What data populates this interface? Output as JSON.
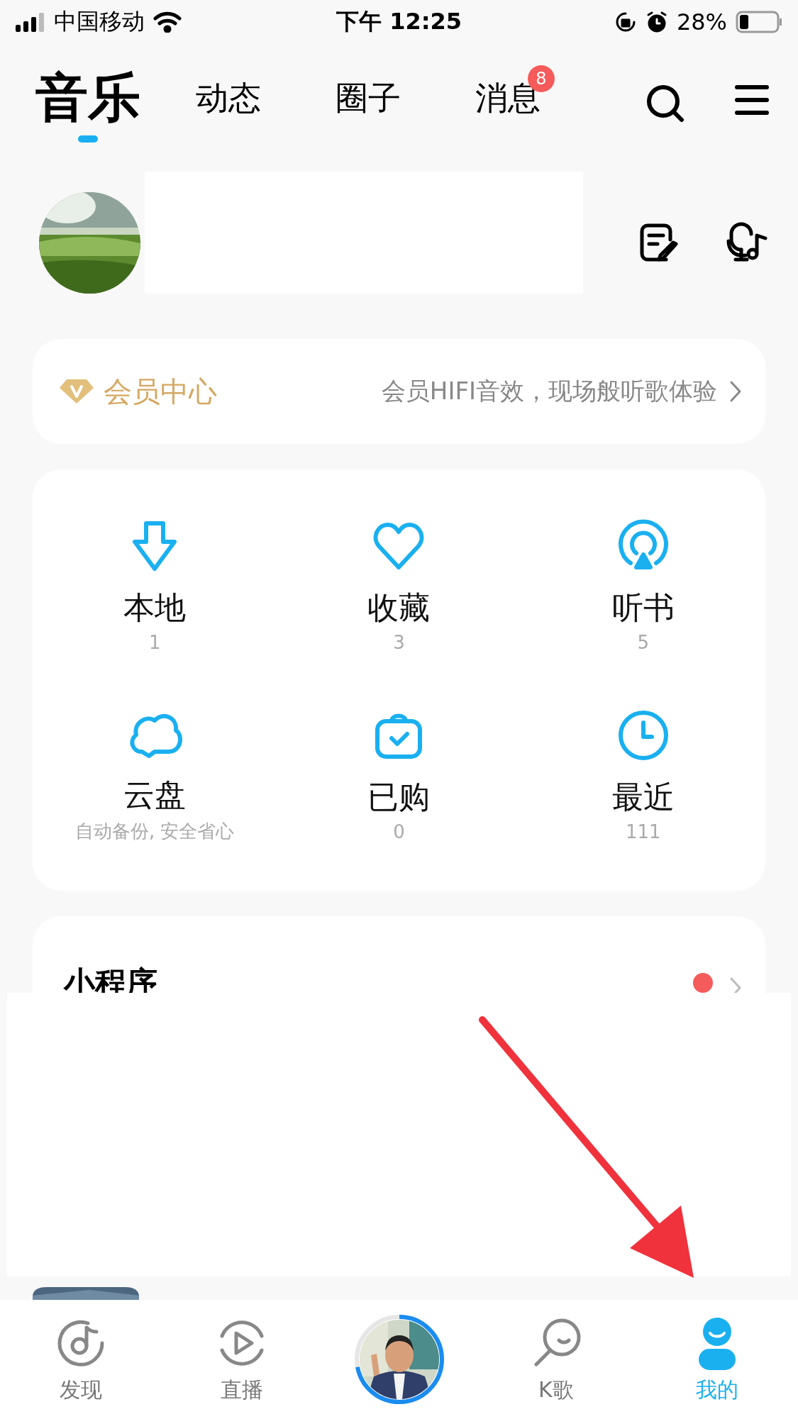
{
  "status_bar": {
    "carrier": "中国移动",
    "time": "下午 12:25",
    "battery": "28%"
  },
  "tabs": [
    {
      "label": "音乐",
      "selected": true
    },
    {
      "label": "动态",
      "selected": false
    },
    {
      "label": "圈子",
      "selected": false
    },
    {
      "label": "消息",
      "selected": false,
      "badge": "8"
    }
  ],
  "vip": {
    "title": "会员中心",
    "subtitle": "会员HIFI音效，现场般听歌体验"
  },
  "shortcuts": [
    {
      "label": "本地",
      "sub": "1"
    },
    {
      "label": "收藏",
      "sub": "3"
    },
    {
      "label": "听书",
      "sub": "5"
    },
    {
      "label": "云盘",
      "sub": "自动备份, 安全省心"
    },
    {
      "label": "已购",
      "sub": "0"
    },
    {
      "label": "最近",
      "sub": "111"
    }
  ],
  "mini_programs": {
    "title": "小程序",
    "has_new": true
  },
  "bottom_nav": [
    {
      "kind": "tab",
      "label": "发现",
      "selected": false
    },
    {
      "kind": "tab",
      "label": "直播",
      "selected": false
    },
    {
      "kind": "player"
    },
    {
      "kind": "tab",
      "label": "K歌",
      "selected": false
    },
    {
      "kind": "tab",
      "label": "我的",
      "selected": true
    }
  ]
}
